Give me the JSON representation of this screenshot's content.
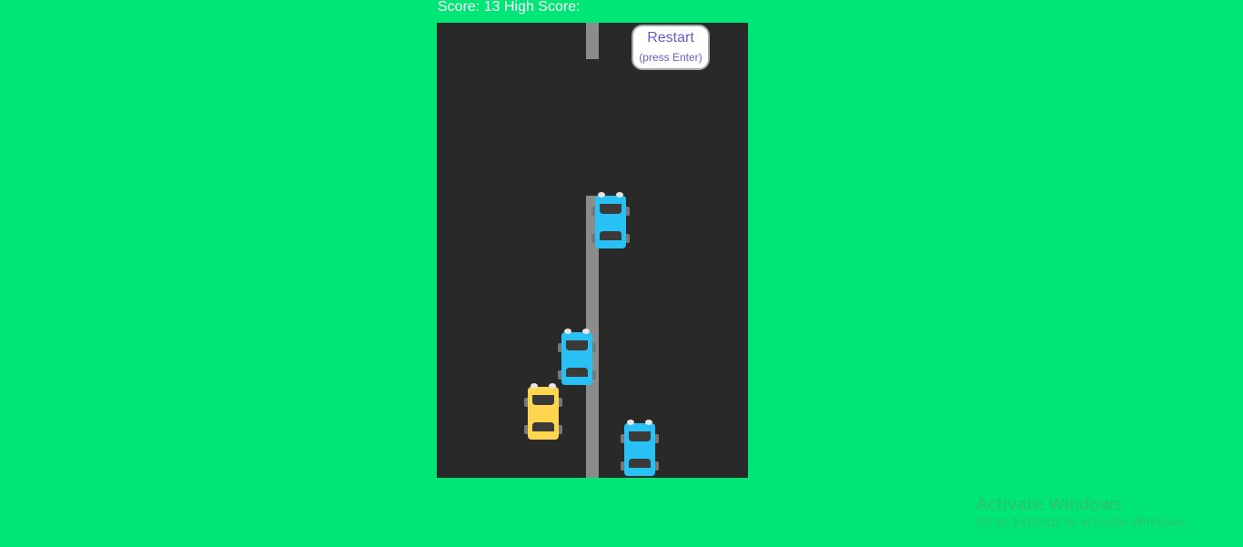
{
  "hud": {
    "score_label": "Score:",
    "score": "13",
    "high_score_label": "High Score:"
  },
  "restart": {
    "label": "Restart",
    "hint": "(press Enter)"
  },
  "colors": {
    "background": "#00e676",
    "road": "#292929",
    "lane": "#8c8c8c",
    "player_car": "#ffd54f",
    "traffic_car": "#29c0f5",
    "button_text": "#6a5acd"
  },
  "cars": [
    {
      "role": "traffic",
      "icon": "blue-car-icon"
    },
    {
      "role": "traffic",
      "icon": "blue-car-icon"
    },
    {
      "role": "player",
      "icon": "yellow-car-icon"
    },
    {
      "role": "traffic",
      "icon": "blue-car-icon"
    }
  ],
  "watermark": {
    "title": "Activate Windows",
    "subtitle": "Go to Settings to activate Windows."
  }
}
